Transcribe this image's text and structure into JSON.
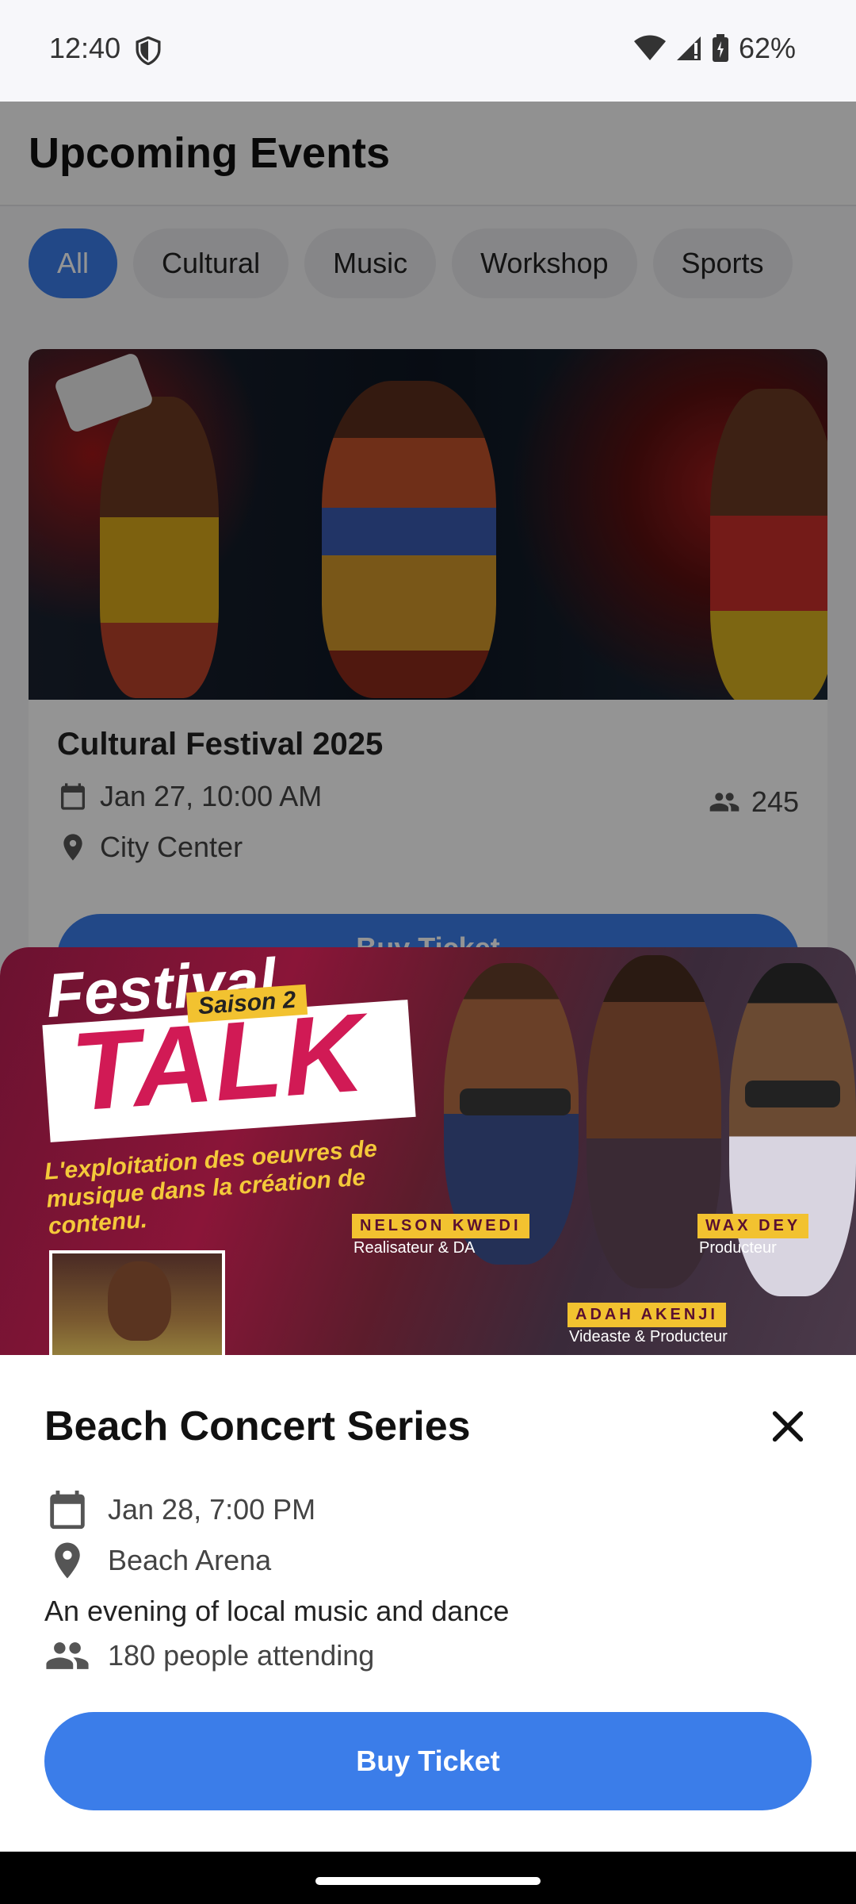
{
  "status_bar": {
    "time": "12:40",
    "battery": "62%"
  },
  "app": {
    "title": "Upcoming Events",
    "chips": [
      "All",
      "Cultural",
      "Music",
      "Workshop",
      "Sports"
    ],
    "card": {
      "title": "Cultural Festival 2025",
      "date": "Jan 27, 10:00 AM",
      "attendees": "245",
      "location": "City Center",
      "button_label": "Buy Ticket"
    }
  },
  "sheet": {
    "poster": {
      "festival": "Festival",
      "saison": "Saison 2",
      "talk": "TALK",
      "subtitle": "L'exploitation des oeuvres de musique dans la création de contenu.",
      "speakers": [
        {
          "name": "NELSON KWEDI",
          "role": "Realisateur & DA"
        },
        {
          "name": "WAX DEY",
          "role": "Producteur"
        },
        {
          "name": "ADAH AKENJI",
          "role": "Videaste & Producteur"
        }
      ]
    },
    "title": "Beach Concert Series",
    "date": "Jan 28, 7:00 PM",
    "location": "Beach Arena",
    "description": "An evening of local music and dance",
    "attending": "180 people attending",
    "button_label": "Buy Ticket"
  },
  "colors": {
    "accent": "#3b7de9",
    "chip_bg": "#e7e7ea"
  },
  "icons": [
    "shield-icon",
    "wifi-icon",
    "signal-icon",
    "battery-icon",
    "calendar-icon",
    "people-icon",
    "location-pin-icon",
    "close-icon"
  ]
}
